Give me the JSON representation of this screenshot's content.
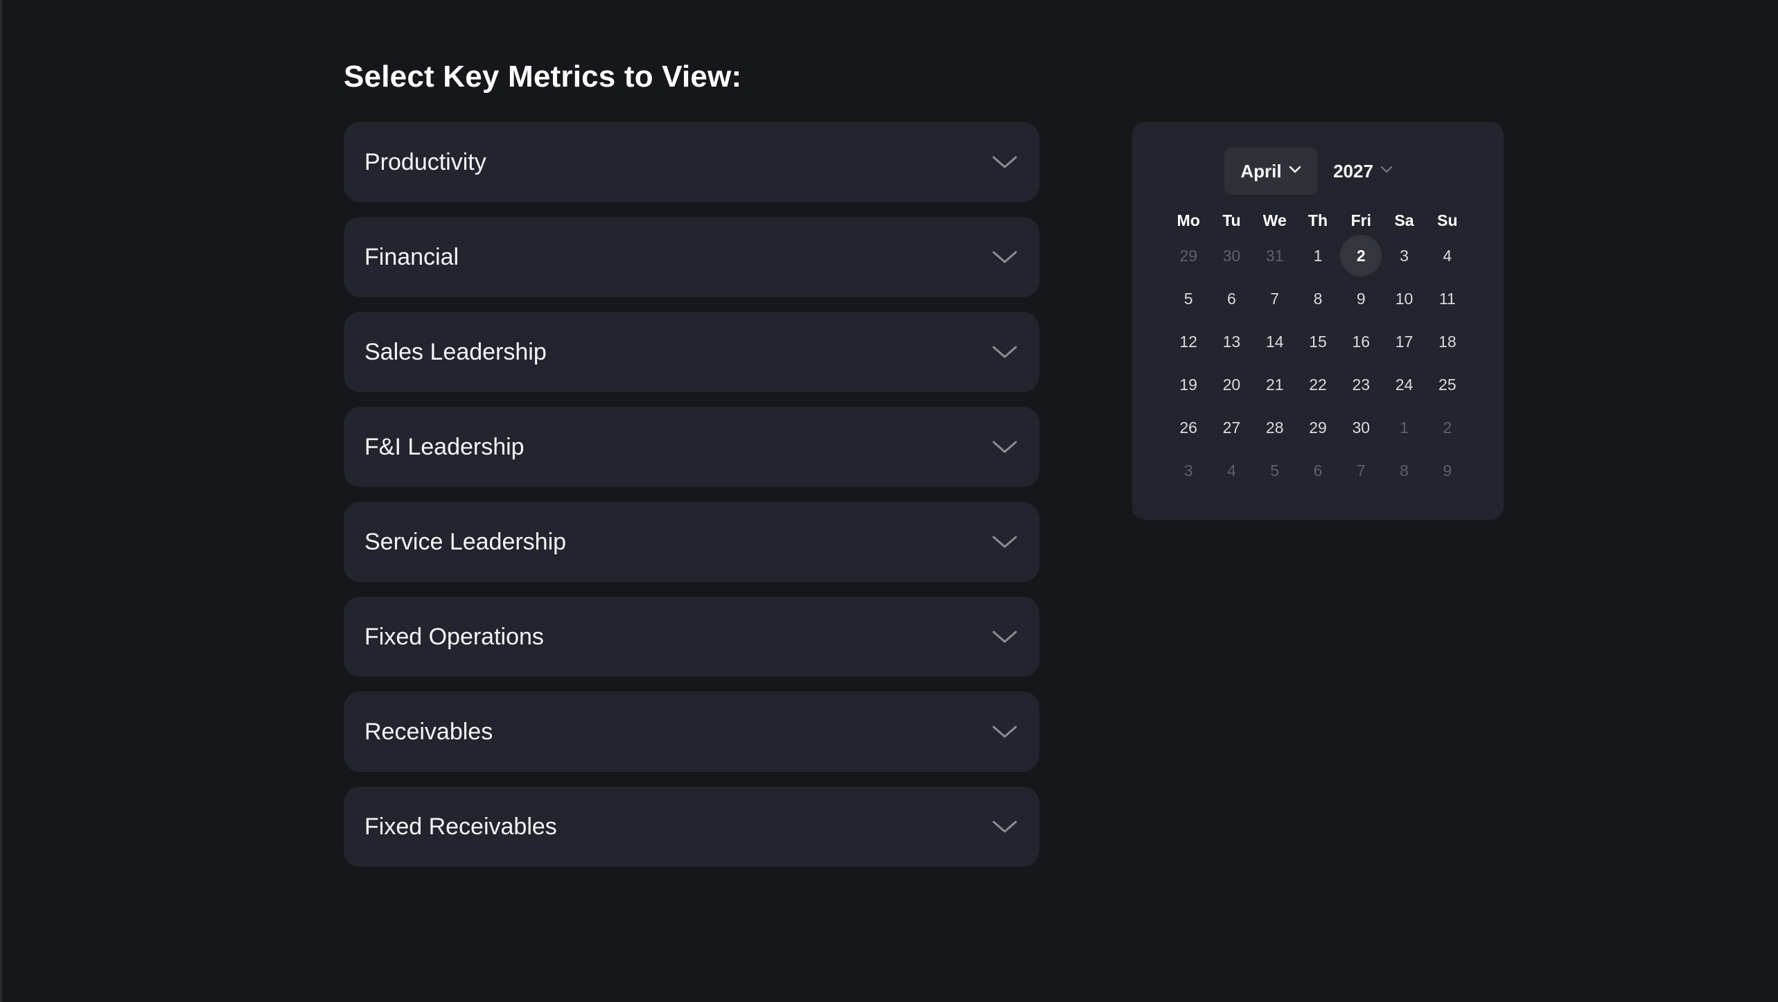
{
  "heading": "Select Key Metrics to View:",
  "metrics": [
    "Productivity",
    "Financial",
    "Sales Leadership",
    "F&I Leadership",
    "Service Leadership",
    "Fixed Operations",
    "Receivables",
    "Fixed Receivables"
  ],
  "calendar": {
    "month": "April",
    "year": "2027",
    "weekdays": [
      "Mo",
      "Tu",
      "We",
      "Th",
      "Fri",
      "Sa",
      "Su"
    ],
    "selected_day": "2",
    "weeks": [
      [
        {
          "d": "29",
          "m": true
        },
        {
          "d": "30",
          "m": true
        },
        {
          "d": "31",
          "m": true
        },
        {
          "d": "1",
          "m": false
        },
        {
          "d": "2",
          "m": false,
          "sel": true
        },
        {
          "d": "3",
          "m": false
        },
        {
          "d": "4",
          "m": false
        }
      ],
      [
        {
          "d": "5",
          "m": false
        },
        {
          "d": "6",
          "m": false
        },
        {
          "d": "7",
          "m": false
        },
        {
          "d": "8",
          "m": false
        },
        {
          "d": "9",
          "m": false
        },
        {
          "d": "10",
          "m": false
        },
        {
          "d": "11",
          "m": false
        }
      ],
      [
        {
          "d": "12",
          "m": false
        },
        {
          "d": "13",
          "m": false
        },
        {
          "d": "14",
          "m": false
        },
        {
          "d": "15",
          "m": false
        },
        {
          "d": "16",
          "m": false
        },
        {
          "d": "17",
          "m": false
        },
        {
          "d": "18",
          "m": false
        }
      ],
      [
        {
          "d": "19",
          "m": false
        },
        {
          "d": "20",
          "m": false
        },
        {
          "d": "21",
          "m": false
        },
        {
          "d": "22",
          "m": false
        },
        {
          "d": "23",
          "m": false
        },
        {
          "d": "24",
          "m": false
        },
        {
          "d": "25",
          "m": false
        }
      ],
      [
        {
          "d": "26",
          "m": false
        },
        {
          "d": "27",
          "m": false
        },
        {
          "d": "28",
          "m": false
        },
        {
          "d": "29",
          "m": false
        },
        {
          "d": "30",
          "m": false
        },
        {
          "d": "1",
          "m": true
        },
        {
          "d": "2",
          "m": true
        }
      ],
      [
        {
          "d": "3",
          "m": true
        },
        {
          "d": "4",
          "m": true
        },
        {
          "d": "5",
          "m": true
        },
        {
          "d": "6",
          "m": true
        },
        {
          "d": "7",
          "m": true
        },
        {
          "d": "8",
          "m": true
        },
        {
          "d": "9",
          "m": true
        }
      ]
    ]
  },
  "colors": {
    "background": "#16171b",
    "panel": "#22252d",
    "text": "#f4f5f7",
    "muted": "#5d6068",
    "chevron": "#8a8d94"
  },
  "icons": {
    "accordion_toggle": "chevron-down-icon",
    "select_toggle": "chevron-down-icon"
  }
}
